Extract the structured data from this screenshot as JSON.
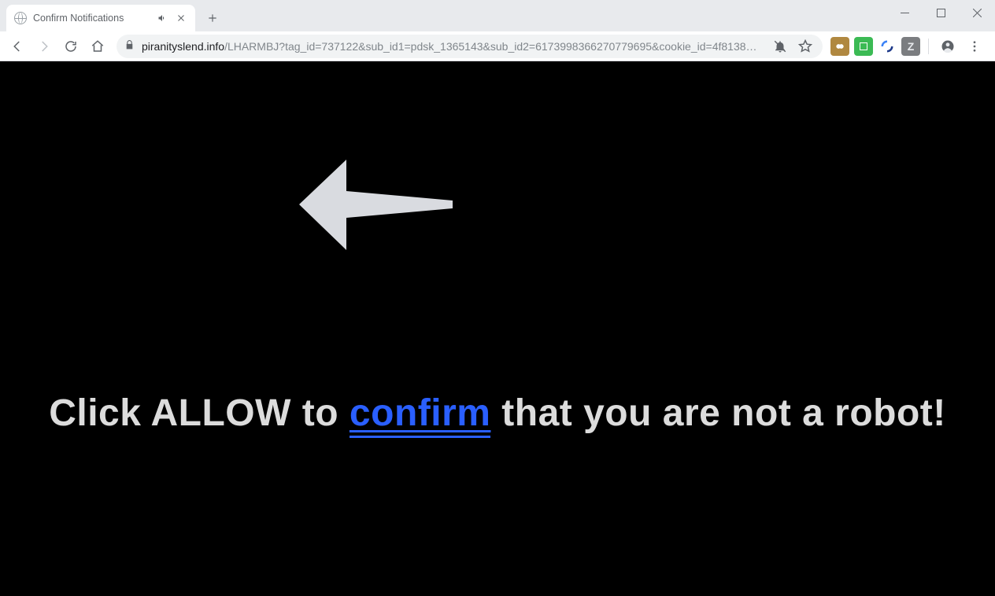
{
  "tab": {
    "title": "Confirm Notifications"
  },
  "toolbar": {
    "url_domain": "piranityslend.info",
    "url_path": "/LHARMBJ?tag_id=737122&sub_id1=pdsk_1365143&sub_id2=6173998366270779695&cookie_id=4f8138…"
  },
  "extensions": {
    "e4_label": "Z"
  },
  "page": {
    "headline_before": "Click ALLOW to ",
    "headline_link": "confirm",
    "headline_after": " that you are not a robot!"
  }
}
